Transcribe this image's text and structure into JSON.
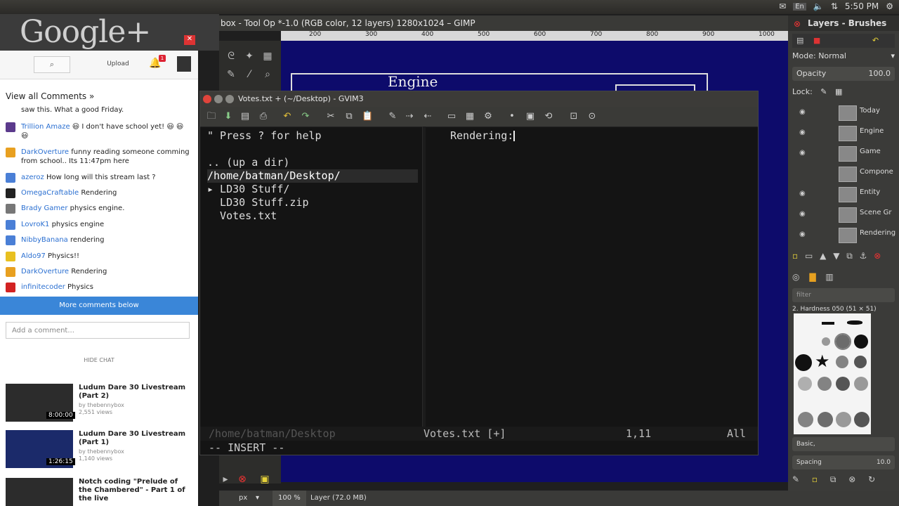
{
  "system": {
    "keyboard": "En",
    "clock": "5:50 PM"
  },
  "gimp": {
    "title": "box - Tool Op *-1.0 (RGB color, 12 layers) 1280x1024 – GIMP",
    "ruler_ticks": [
      "200",
      "300",
      "400",
      "500",
      "600",
      "700",
      "800",
      "900",
      "1000"
    ],
    "canvas_text": "Engine",
    "status": {
      "unit": "px",
      "zoom": "100 %",
      "layer_info": "Layer (72.0 MB)"
    }
  },
  "dock": {
    "title": "Layers - Brushes",
    "mode_label": "Mode:",
    "mode_value": "Normal",
    "opacity_label": "Opacity",
    "opacity_value": "100.0",
    "lock_label": "Lock:",
    "layers": [
      "Today",
      "Engine",
      "Game",
      "Compone",
      "Entity",
      "Scene Gr",
      "Rendering"
    ],
    "filter_placeholder": "filter",
    "brush_name": "2. Hardness 050 (51 × 51)",
    "brush_set": "Basic,",
    "spacing_label": "Spacing",
    "spacing_value": "10.0"
  },
  "gplus": {
    "logo": "Google+",
    "upload_label": "Upload",
    "notif_count": "1",
    "view_all": "View all Comments »",
    "comments": [
      {
        "user": "",
        "text": "saw this. What a good Friday.",
        "color": "#ffffff"
      },
      {
        "user": "Trillion Amaze",
        "text": "😃 I don't have school yet! 😃 😃 😃",
        "color": "#5b3a8c"
      },
      {
        "user": "DarkOverture",
        "text": "funny reading someone comming from school.. Its 11:47pm here",
        "color": "#e8a020"
      },
      {
        "user": "azeroz",
        "text": "How long will this stream last ?",
        "color": "#4a7fd6"
      },
      {
        "user": "OmegaCraftable",
        "text": "Rendering",
        "color": "#222222"
      },
      {
        "user": "Brady Gamer",
        "text": "physics engine.",
        "color": "#777777"
      },
      {
        "user": "LovroK1",
        "text": "physics engine",
        "color": "#4a7fd6"
      },
      {
        "user": "NibbyBanana",
        "text": "rendering",
        "color": "#4a7fd6"
      },
      {
        "user": "Aldo97",
        "text": "Physics!!",
        "color": "#e8c020"
      },
      {
        "user": "DarkOverture",
        "text": "Rendering",
        "color": "#e8a020"
      },
      {
        "user": "infinitecoder",
        "text": "Physics",
        "color": "#d22222"
      }
    ],
    "more_comments": "More comments below",
    "add_comment_placeholder": "Add a comment...",
    "hide_chat": "HIDE CHAT",
    "videos": [
      {
        "title": "Ludum Dare 30 Livestream (Part 2)",
        "by": "by thebennybox",
        "views": "2,551 views",
        "duration": "8:00:00"
      },
      {
        "title": "Ludum Dare 30 Livestream (Part 1)",
        "by": "by thebennybox",
        "views": "1,140 views",
        "duration": "1:26:15"
      },
      {
        "title": "Notch coding \"Prelude of the Chambered\" - Part 1 of the live",
        "by": "",
        "views": "",
        "duration": ""
      }
    ]
  },
  "gvim": {
    "title": "Votes.txt + (~/Desktop) - GVIM3",
    "help_line": "\" Press ? for help",
    "tree": [
      ".. (up a dir)",
      "/home/batman/Desktop/",
      "▸ LD30 Stuff/",
      "  LD30 Stuff.zip",
      "  Votes.txt"
    ],
    "editor_line": "Rendering:",
    "status_left": "/home/batman/Desktop",
    "status_file": "Votes.txt [+]",
    "status_pos": "1,11",
    "status_all": "All",
    "mode": "-- INSERT --"
  }
}
